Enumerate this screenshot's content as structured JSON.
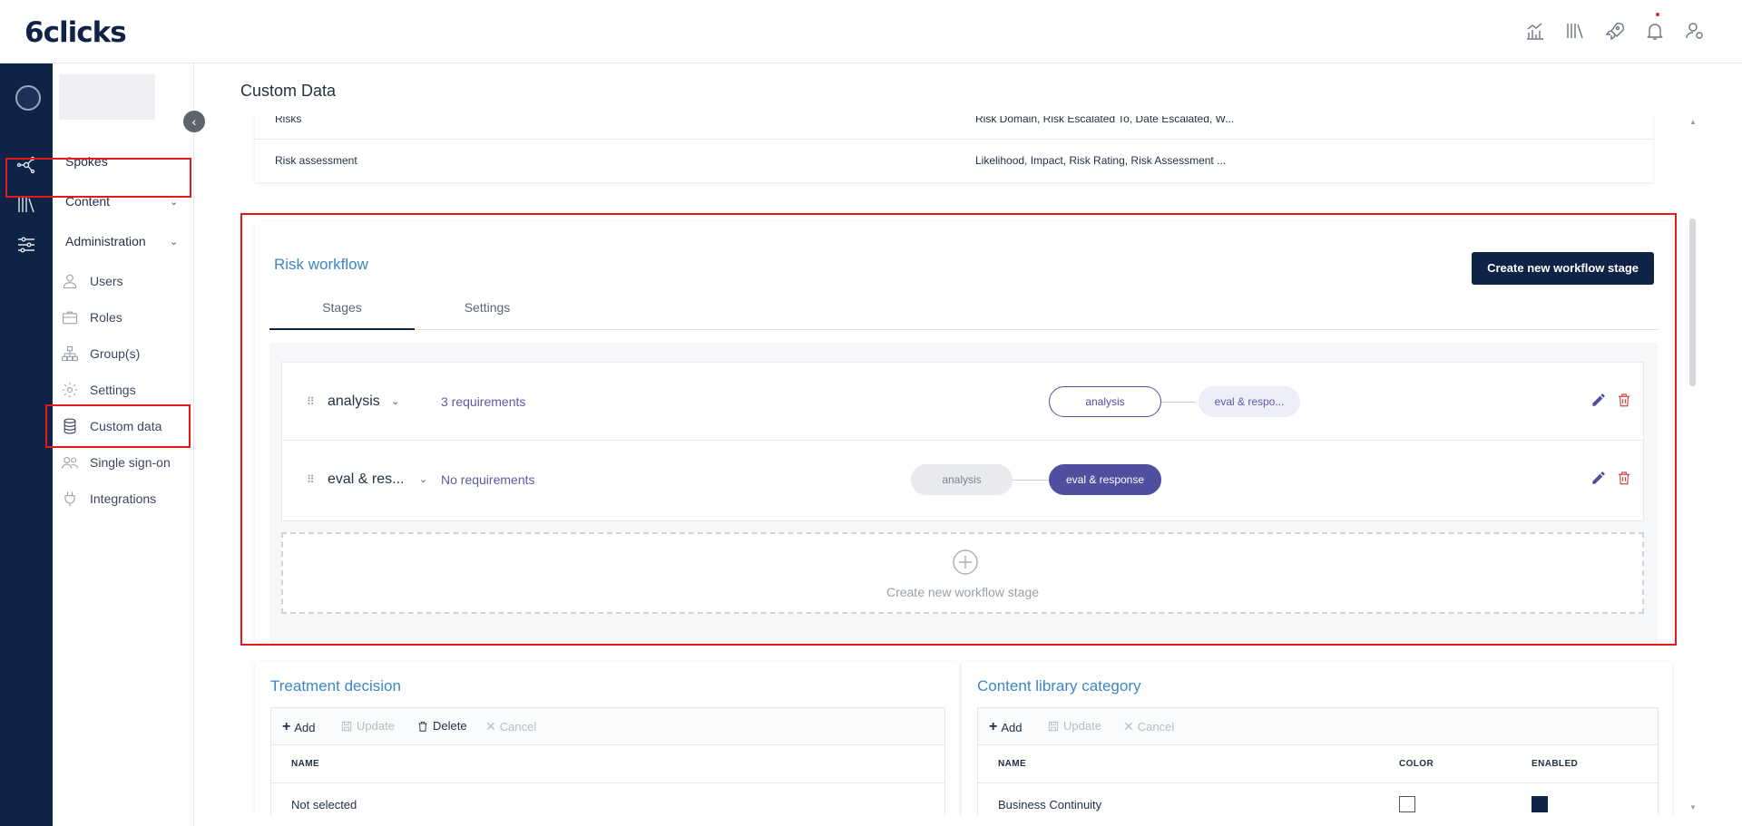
{
  "app": {
    "logo": "6clicks"
  },
  "topbar": {
    "icons": [
      "analytics-icon",
      "library-icon",
      "rocket-icon",
      "bell-icon",
      "user-settings-icon"
    ]
  },
  "rail": {
    "icons": [
      "avatar",
      "spokes-icon",
      "content-icon",
      "administration-icon"
    ]
  },
  "sidenav": {
    "collapse_label": "‹",
    "items": [
      {
        "label": "Spokes"
      },
      {
        "label": "Content",
        "chevron": "⌄"
      },
      {
        "label": "Administration",
        "chevron": "⌄"
      }
    ],
    "sub_items": [
      {
        "label": "Users",
        "icon": "user-icon"
      },
      {
        "label": "Roles",
        "icon": "briefcase-icon"
      },
      {
        "label": "Group(s)",
        "icon": "hierarchy-icon"
      },
      {
        "label": "Settings",
        "icon": "gear-icon"
      },
      {
        "label": "Custom data",
        "icon": "database-icon"
      },
      {
        "label": "Single sign-on",
        "icon": "users-icon"
      },
      {
        "label": "Integrations",
        "icon": "plug-icon"
      }
    ]
  },
  "main": {
    "title": "Custom Data",
    "top_table": {
      "rows": [
        {
          "name": "Risks",
          "fields": "Risk Domain, Risk Escalated To, Date Escalated, W..."
        },
        {
          "name": "Risk assessment",
          "fields": "Likelihood, Impact, Risk Rating, Risk Assessment ..."
        }
      ]
    },
    "risk_workflow": {
      "title": "Risk workflow",
      "create_button": "Create new workflow stage",
      "tabs": [
        {
          "label": "Stages"
        },
        {
          "label": "Settings"
        }
      ],
      "stages": [
        {
          "name": "analysis",
          "requirements": "3 requirements",
          "pills": [
            {
              "label": "analysis",
              "style": "outline"
            },
            {
              "label": "eval & respo...",
              "style": "light"
            }
          ]
        },
        {
          "name": "eval & res...",
          "requirements": "No requirements",
          "pills": [
            {
              "label": "analysis",
              "style": "grey"
            },
            {
              "label": "eval & response",
              "style": "filled"
            }
          ]
        }
      ],
      "new_stage_label": "Create new workflow stage"
    },
    "treatment_decision": {
      "title": "Treatment decision",
      "toolbar": {
        "add": "Add",
        "update": "Update",
        "delete": "Delete",
        "cancel": "Cancel"
      },
      "columns": {
        "name": "NAME"
      },
      "rows": [
        {
          "name": "Not selected"
        }
      ]
    },
    "content_library": {
      "title": "Content library category",
      "toolbar": {
        "add": "Add",
        "update": "Update",
        "cancel": "Cancel"
      },
      "columns": {
        "name": "NAME",
        "color": "COLOR",
        "enabled": "ENABLED"
      },
      "rows": [
        {
          "name": "Business Continuity",
          "enabled": true
        }
      ]
    }
  },
  "colors": {
    "brand_navy": "#0f2347",
    "accent_blue": "#3b86c4",
    "workflow_purple": "#4e4f9f",
    "highlight_red": "#e01b1b"
  }
}
